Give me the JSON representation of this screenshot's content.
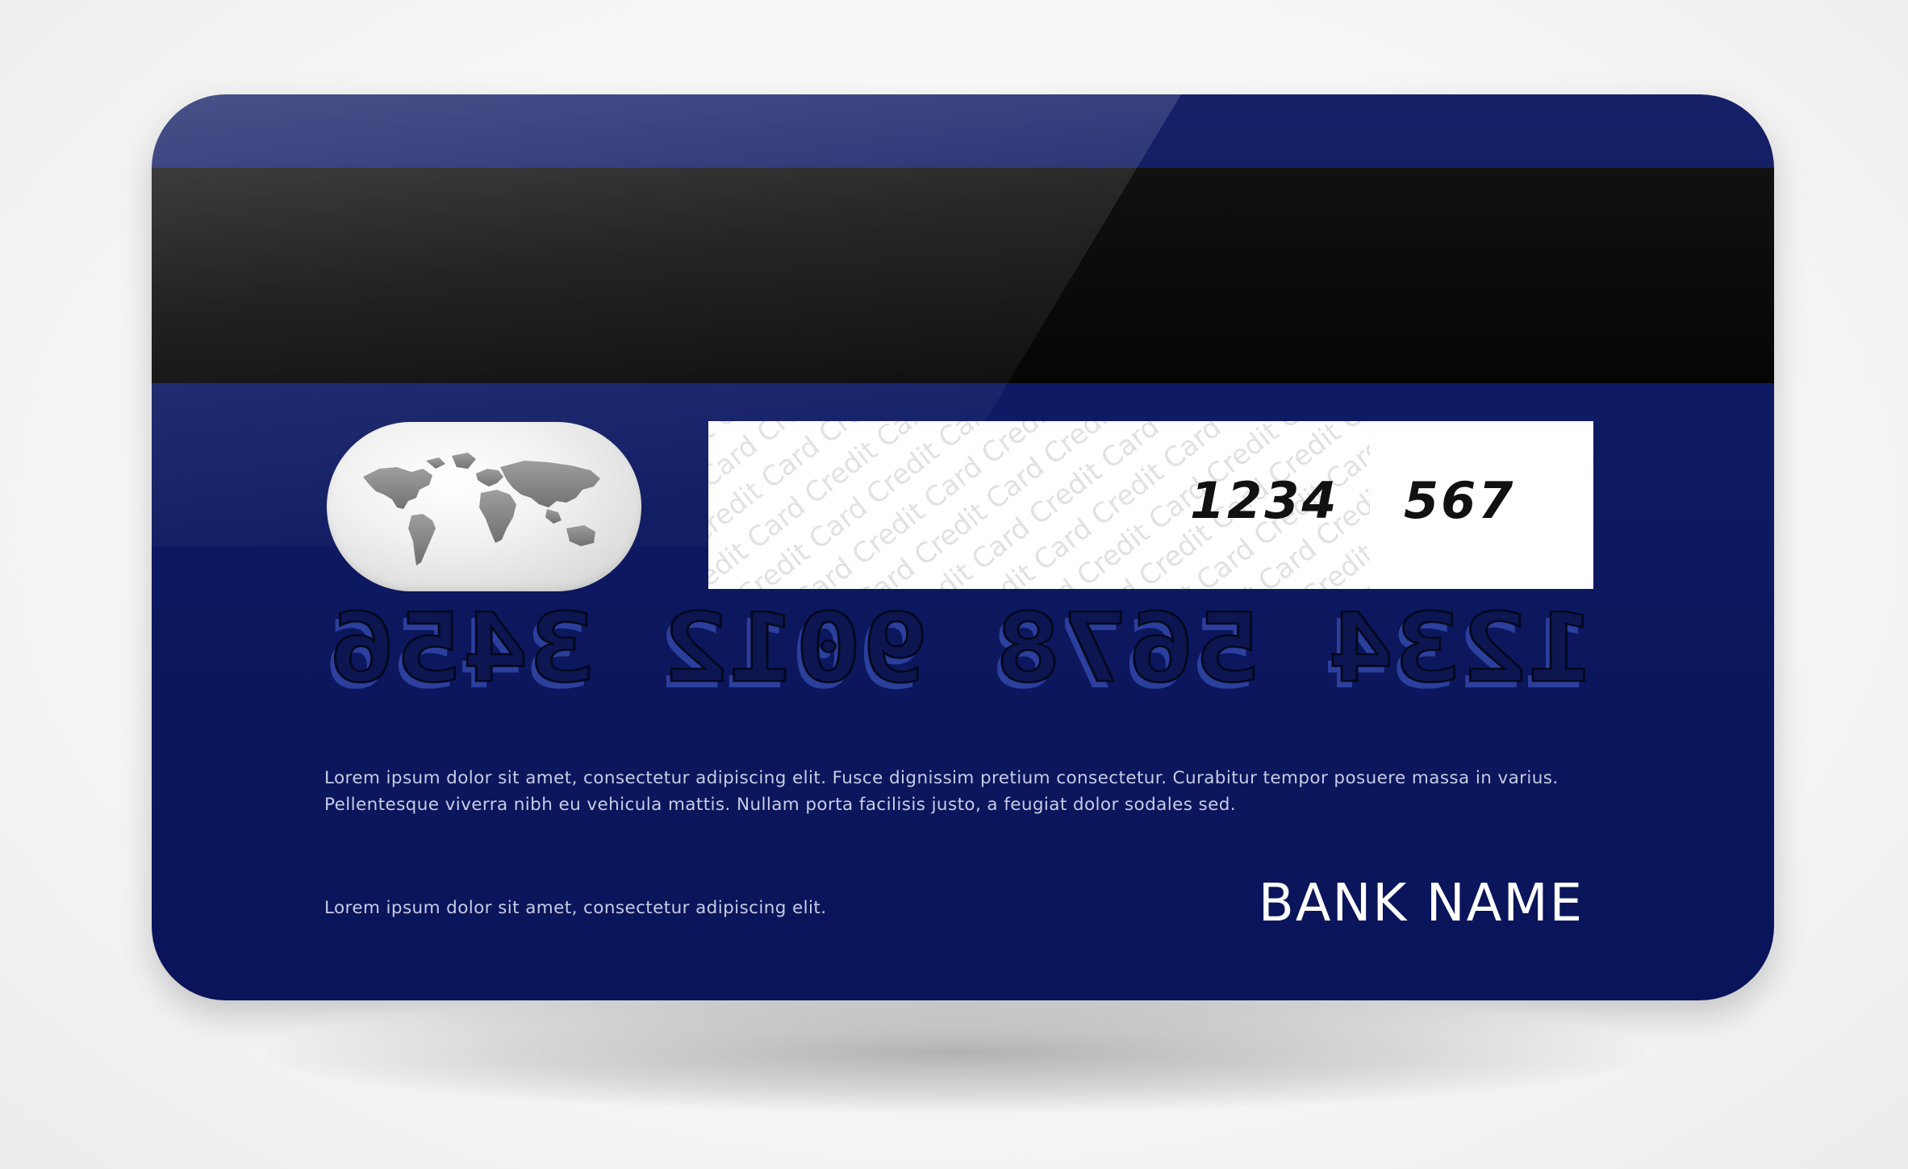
{
  "card": {
    "panel_numbers": [
      "1234",
      "567"
    ],
    "watermark_text": "Credit Card",
    "embossed_number": "1234 5678 9012 3456",
    "disclaimer": "Lorem ipsum dolor sit amet, consectetur adipiscing elit. Fusce dignissim pretium consectetur. Curabitur tempor posuere massa in varius. Pellentesque viverra nibh eu vehicula mattis. Nullam porta facilisis justo, a feugiat dolor sodales sed.",
    "footer_note": "Lorem ipsum dolor sit amet, consectetur adipiscing elit.",
    "bank_name": "BANK NAME"
  },
  "colors": {
    "card_blue": "#0e1a63",
    "stripe": "#0a0a0a",
    "panel": "#ffffff"
  },
  "icons": {
    "hologram": "world-map-icon"
  }
}
